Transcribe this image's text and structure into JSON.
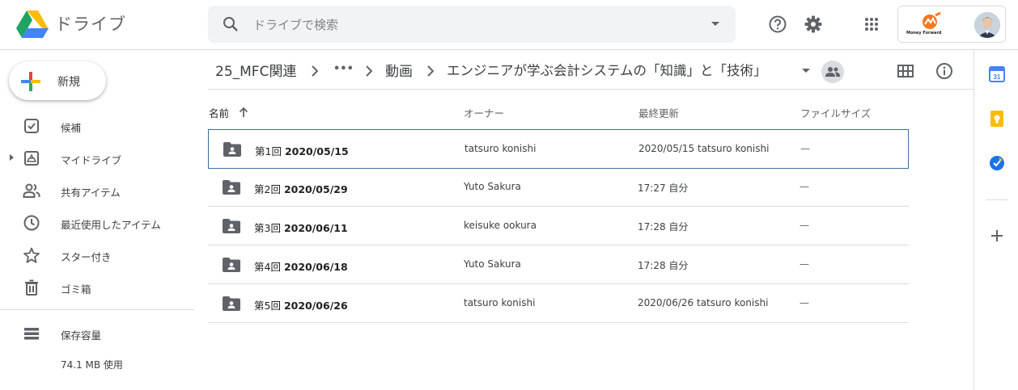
{
  "header": {
    "app_title": "ドライブ",
    "search_placeholder": "ドライブで検索",
    "icons": [
      "drive-logo-icon",
      "search-icon",
      "help-icon",
      "settings-icon",
      "apps-grid-icon"
    ],
    "account_logo_text": "Money Forward"
  },
  "sidebar": {
    "new_label": "新規",
    "items": [
      {
        "label": "候補",
        "icon": "suggested-check-icon"
      },
      {
        "label": "マイドライブ",
        "icon": "my-drive-icon"
      },
      {
        "label": "共有アイテム",
        "icon": "shared-people-icon"
      },
      {
        "label": "最近使用したアイテム",
        "icon": "clock-icon"
      },
      {
        "label": "スター付き",
        "icon": "star-icon"
      },
      {
        "label": "ゴミ箱",
        "icon": "trash-icon"
      }
    ],
    "storage_label": "保存容量",
    "storage_used": "74.1 MB 使用"
  },
  "breadcrumb": {
    "root": "25_MFC関連",
    "ellipsis": "•••",
    "middle": "動画",
    "current": "エンジニアが学ぶ会計システムの「知識」と「技術」"
  },
  "table": {
    "headers": {
      "name": "名前",
      "owner": "オーナー",
      "modified": "最終更新",
      "size": "ファイルサイズ"
    },
    "rows": [
      {
        "prefix": "第1回",
        "date": "2020/05/15",
        "owner": "tatsuro konishi",
        "modified_time": "2020/05/15",
        "modified_by": "tatsuro konishi",
        "size": "—"
      },
      {
        "prefix": "第2回",
        "date": "2020/05/29",
        "owner": "Yuto Sakura",
        "modified_time": "17:27",
        "modified_by": "自分",
        "size": "—"
      },
      {
        "prefix": "第3回",
        "date": "2020/06/11",
        "owner": "keisuke ookura",
        "modified_time": "17:28",
        "modified_by": "自分",
        "size": "—"
      },
      {
        "prefix": "第4回",
        "date": "2020/06/18",
        "owner": "Yuto Sakura",
        "modified_time": "17:28",
        "modified_by": "自分",
        "size": "—"
      },
      {
        "prefix": "第5回",
        "date": "2020/06/26",
        "owner": "tatsuro konishi",
        "modified_time": "2020/06/26",
        "modified_by": "tatsuro konishi",
        "size": "—"
      }
    ]
  },
  "right_rail": {
    "icons": [
      "calendar-icon",
      "keep-icon",
      "tasks-icon",
      "add-icon"
    ],
    "calendar_day": "31"
  },
  "colors": {
    "blue": "#4285f4",
    "red": "#ea4335",
    "yellow": "#fbbc04",
    "green": "#34a853",
    "selected_border": "#3b6fa8"
  }
}
